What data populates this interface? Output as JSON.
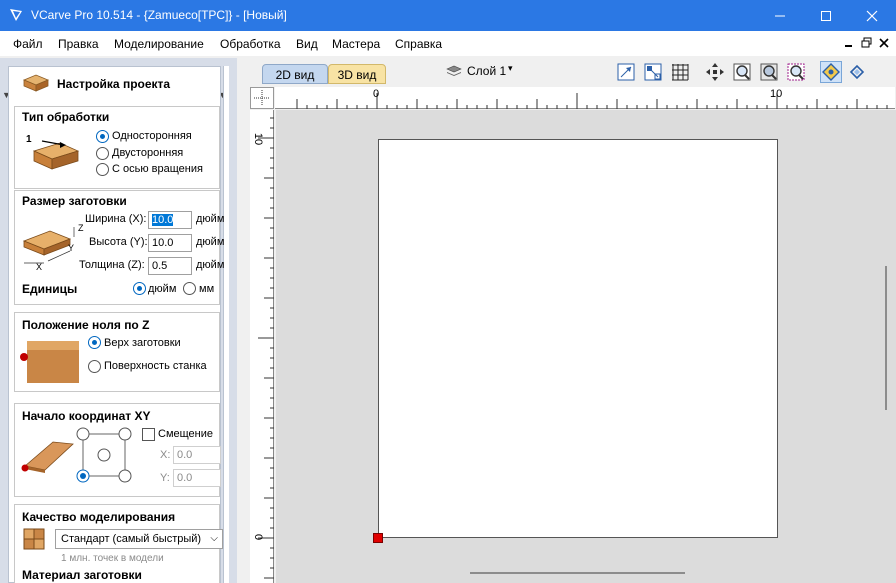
{
  "window": {
    "title": "VCarve Pro 10.514 - {Zamueco[TPC]} - [Новый]",
    "accent": "#2b78e4"
  },
  "menu": [
    "Файл",
    "Правка",
    "Моделирование",
    "Обработка",
    "Вид",
    "Мастера",
    "Справка"
  ],
  "panel": {
    "title": "Настройка проекта",
    "job_type": {
      "title": "Тип обработки",
      "image_label": "1",
      "options": [
        "Односторонняя",
        "Двусторонняя",
        "С осью вращения"
      ],
      "selected": "Односторонняя"
    },
    "material_size": {
      "title": "Размер заготовки",
      "width_label": "Ширина (X):",
      "width_value": "10.0",
      "height_label": "Высота (Y):",
      "height_value": "10.0",
      "thickness_label": "Толщина (Z):",
      "thickness_value": "0.5",
      "unit": "дюйм",
      "axis_x": "X",
      "axis_y": "Y",
      "axis_z": "Z",
      "units_label": "Единицы",
      "units_options": [
        "дюйм",
        "мм"
      ],
      "units_selected": "дюйм"
    },
    "z_zero": {
      "title": "Положение ноля по Z",
      "options": [
        "Верх заготовки",
        "Поверхность станка"
      ],
      "selected": "Верх заготовки"
    },
    "xy_datum": {
      "title": "Начало координат XY",
      "offset_label": "Смещение",
      "x_label": "X:",
      "x_value": "0.0",
      "y_label": "Y:",
      "y_value": "0.0",
      "selected_corner": "bottom-left"
    },
    "modelling_quality": {
      "title": "Качество моделирования",
      "selected": "Стандарт (самый быстрый)",
      "note": "1 млн. точек в модели"
    },
    "material": {
      "title": "Материал заготовки"
    }
  },
  "tabs": {
    "tab_2d": "2D вид",
    "tab_3d": "3D вид",
    "layer": "Слой 1"
  },
  "ruler": {
    "h_labels": [
      "0",
      "10"
    ],
    "v_labels": [
      "10",
      "0"
    ]
  },
  "icons": {
    "toolbar": [
      "select-icon",
      "node-edit-icon",
      "grid-icon",
      "move-icon",
      "zoom-icon",
      "zoom-extents-icon",
      "zoom-selection-icon",
      "snap-icon",
      "transform-icon"
    ]
  }
}
